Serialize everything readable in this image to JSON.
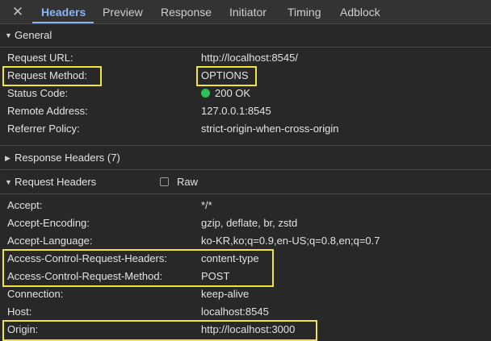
{
  "tabs": [
    {
      "label": "Headers",
      "active": true
    },
    {
      "label": "Preview",
      "active": false
    },
    {
      "label": "Response",
      "active": false
    },
    {
      "label": "Initiator",
      "active": false
    },
    {
      "label": "Timing",
      "active": false
    },
    {
      "label": "Adblock",
      "active": false
    }
  ],
  "close_icon": "close-icon",
  "general": {
    "title": "General",
    "expanded": true,
    "rows": [
      {
        "key": "Request URL:",
        "value": "http://localhost:8545/"
      },
      {
        "key": "Request Method:",
        "value": "OPTIONS"
      },
      {
        "key": "Status Code:",
        "value": "200 OK",
        "status_color": "#2fbf55"
      },
      {
        "key": "Remote Address:",
        "value": "127.0.0.1:8545"
      },
      {
        "key": "Referrer Policy:",
        "value": "strict-origin-when-cross-origin"
      }
    ]
  },
  "response_headers": {
    "title": "Response Headers (7)",
    "expanded": false
  },
  "request_headers": {
    "title": "Request Headers",
    "expanded": true,
    "raw_label": "Raw",
    "raw_checked": false,
    "rows": [
      {
        "key": "Accept:",
        "value": "*/*"
      },
      {
        "key": "Accept-Encoding:",
        "value": "gzip, deflate, br, zstd"
      },
      {
        "key": "Accept-Language:",
        "value": "ko-KR,ko;q=0.9,en-US;q=0.8,en;q=0.7"
      },
      {
        "key": "Access-Control-Request-Headers:",
        "value": "content-type"
      },
      {
        "key": "Access-Control-Request-Method:",
        "value": "POST"
      },
      {
        "key": "Connection:",
        "value": "keep-alive"
      },
      {
        "key": "Host:",
        "value": "localhost:8545"
      },
      {
        "key": "Origin:",
        "value": "http://localhost:3000"
      }
    ]
  },
  "colors": {
    "accent": "#8ab4f8",
    "highlight": "#f3e43b",
    "status_ok": "#2fbf55"
  }
}
